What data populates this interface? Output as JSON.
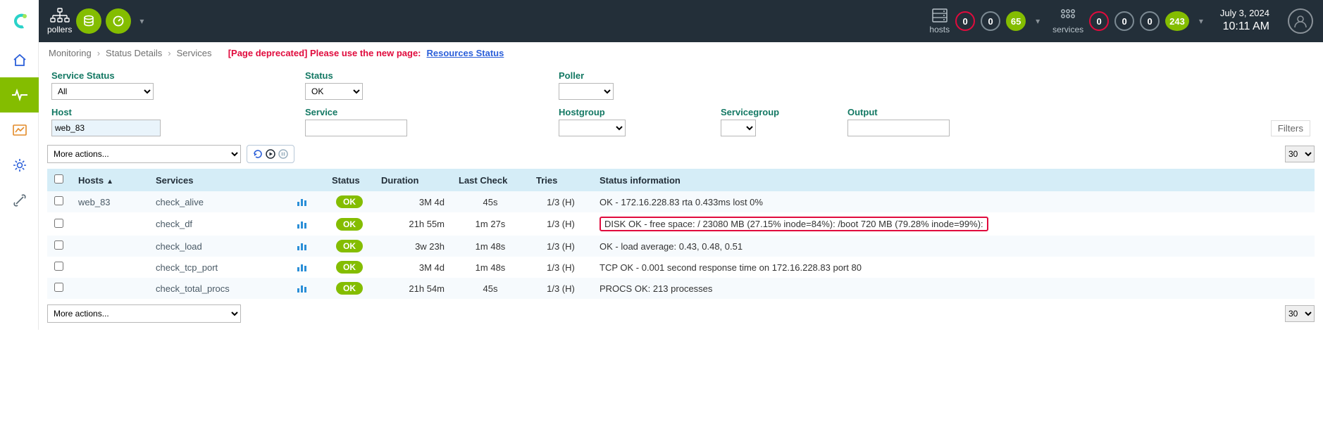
{
  "topbar": {
    "pollers_label": "pollers",
    "hosts_label": "hosts",
    "services_label": "services",
    "host_counters": {
      "red": "0",
      "gray": "0",
      "green": "65"
    },
    "service_counters": {
      "red": "0",
      "gray1": "0",
      "gray2": "0",
      "green": "243"
    },
    "date": "July 3, 2024",
    "time": "10:11 AM"
  },
  "breadcrumb": {
    "a": "Monitoring",
    "b": "Status Details",
    "c": "Services",
    "deprecated": "[Page deprecated] Please use the new page:",
    "link": "Resources Status"
  },
  "filters": {
    "service_status_label": "Service Status",
    "service_status_value": "All",
    "host_label": "Host",
    "host_value": "web_83",
    "status_label": "Status",
    "status_value": "OK",
    "service_label": "Service",
    "service_value": "",
    "poller_label": "Poller",
    "poller_value": "",
    "hostgroup_label": "Hostgroup",
    "hostgroup_value": "",
    "servicegroup_label": "Servicegroup",
    "servicegroup_value": "",
    "output_label": "Output",
    "output_value": "",
    "filters_button": "Filters"
  },
  "actions_placeholder": "More actions...",
  "page_size": "30",
  "columns": {
    "hosts": "Hosts",
    "services": "Services",
    "status": "Status",
    "duration": "Duration",
    "last_check": "Last Check",
    "tries": "Tries",
    "status_info": "Status information"
  },
  "rows": [
    {
      "host": "web_83",
      "service": "check_alive",
      "status": "OK",
      "duration": "3M 4d",
      "last_check": "45s",
      "tries": "1/3 (H)",
      "info": "OK - 172.16.228.83 rta 0.433ms lost 0%",
      "highlight": false
    },
    {
      "host": "",
      "service": "check_df",
      "status": "OK",
      "duration": "21h 55m",
      "last_check": "1m 27s",
      "tries": "1/3 (H)",
      "info": "DISK OK - free space: / 23080 MB (27.15% inode=84%): /boot 720 MB (79.28% inode=99%):",
      "highlight": true
    },
    {
      "host": "",
      "service": "check_load",
      "status": "OK",
      "duration": "3w 23h",
      "last_check": "1m 48s",
      "tries": "1/3 (H)",
      "info": "OK - load average: 0.43, 0.48, 0.51",
      "highlight": false
    },
    {
      "host": "",
      "service": "check_tcp_port",
      "status": "OK",
      "duration": "3M 4d",
      "last_check": "1m 48s",
      "tries": "1/3 (H)",
      "info": "TCP OK - 0.001 second response time on 172.16.228.83 port 80",
      "highlight": false
    },
    {
      "host": "",
      "service": "check_total_procs",
      "status": "OK",
      "duration": "21h 54m",
      "last_check": "45s",
      "tries": "1/3 (H)",
      "info": "PROCS OK: 213 processes",
      "highlight": false
    }
  ]
}
